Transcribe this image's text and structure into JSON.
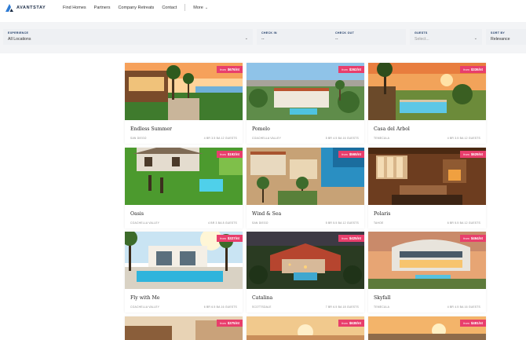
{
  "brand": {
    "name": "AVANTSTAY"
  },
  "nav": {
    "links": [
      "Find Homes",
      "Partners",
      "Company Retreats",
      "Contact"
    ],
    "more_label": "More"
  },
  "filters": {
    "experience": {
      "label": "EXPERIENCE",
      "value": "All Locations"
    },
    "check_in": {
      "label": "CHECK IN",
      "value": "--"
    },
    "check_out": {
      "label": "CHECK OUT",
      "value": "--"
    },
    "guests": {
      "label": "GUESTS",
      "placeholder": "Select..."
    },
    "sort_by": {
      "label": "SORT BY",
      "value": "Relevance"
    }
  },
  "price_prefix": "from",
  "listings": [
    {
      "name": "Endless Summer",
      "location": "SAN DIEGO",
      "specs": "4 BR 3.5 BA 12 GUESTS",
      "price": "$676/nt"
    },
    {
      "name": "Pomelo",
      "location": "COACHELLA VALLEY",
      "specs": "5 BR 4.5 BA 16 GUESTS",
      "price": "$362/nt"
    },
    {
      "name": "Casa del Arbol",
      "location": "TEMECULA",
      "specs": "4 BR 3.5 BA 12 GUESTS",
      "price": "$336/nt"
    },
    {
      "name": "Oasis",
      "location": "COACHELLA VALLEY",
      "specs": "4 BR 3 BA 8 GUESTS",
      "price": "$192/nt"
    },
    {
      "name": "Wind & Sea",
      "location": "SAN DIEGO",
      "specs": "5 BR 5.5 BA 12 GUESTS",
      "price": "$565/nt"
    },
    {
      "name": "Polaris",
      "location": "TAHOE",
      "specs": "6 BR 5.5 BA 12 GUESTS",
      "price": "$629/nt"
    },
    {
      "name": "Fly with Me",
      "location": "COACHELLA VALLEY",
      "specs": "6 BR 6.5 BA 16 GUESTS",
      "price": "$327/nt"
    },
    {
      "name": "Catalina",
      "location": "SCOTTSDALE",
      "specs": "7 BR 6.5 BA 18 GUESTS",
      "price": "$425/nt"
    },
    {
      "name": "Skyfall",
      "location": "TEMECULA",
      "specs": "4 BR 4.5 BA 16 GUESTS",
      "price": "$464/nt"
    },
    {
      "name": "",
      "location": "",
      "specs": "",
      "price": "$375/nt"
    },
    {
      "name": "",
      "location": "",
      "specs": "",
      "price": "$638/nt"
    },
    {
      "name": "",
      "location": "",
      "specs": "",
      "price": "$481/nt"
    }
  ],
  "colors": {
    "accent": "#e83e6c",
    "brand": "#1a2b45",
    "brand_blue": "#2e7bd4"
  }
}
